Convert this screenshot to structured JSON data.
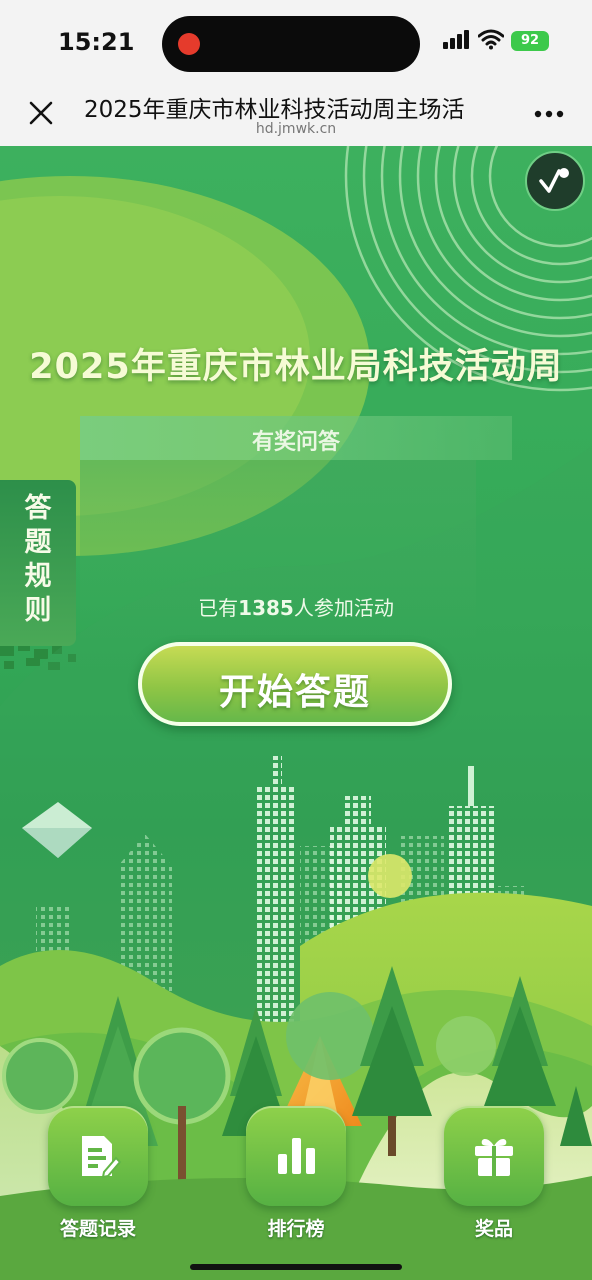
{
  "status_bar": {
    "time": "15:21",
    "battery": "92",
    "icons": [
      "recording-dot-icon",
      "signal-icon",
      "wifi-icon",
      "battery-icon"
    ]
  },
  "nav_bar": {
    "title": "2025年重庆市林业科技活动周主场活",
    "url": "hd.jmwk.cn",
    "icons": [
      "close-icon",
      "more-icon"
    ]
  },
  "page": {
    "main_title": "2025年重庆市林业局科技活动周",
    "subtitle": "有奖问答",
    "rules_label": "答题规则",
    "participants_prefix": "已有",
    "participants_count": "1385",
    "participants_suffix": "人参加活动",
    "start_button": "开始答题",
    "music_icon": "music-icon"
  },
  "bottom_nav": {
    "items": [
      {
        "label": "答题记录",
        "icon": "answer-record-icon"
      },
      {
        "label": "排行榜",
        "icon": "leaderboard-icon"
      },
      {
        "label": "奖品",
        "icon": "gift-icon"
      }
    ]
  },
  "colors": {
    "background_green": "#34a957",
    "button_yellow_green": "#c6db54",
    "title_cream": "#f6fbd5"
  }
}
